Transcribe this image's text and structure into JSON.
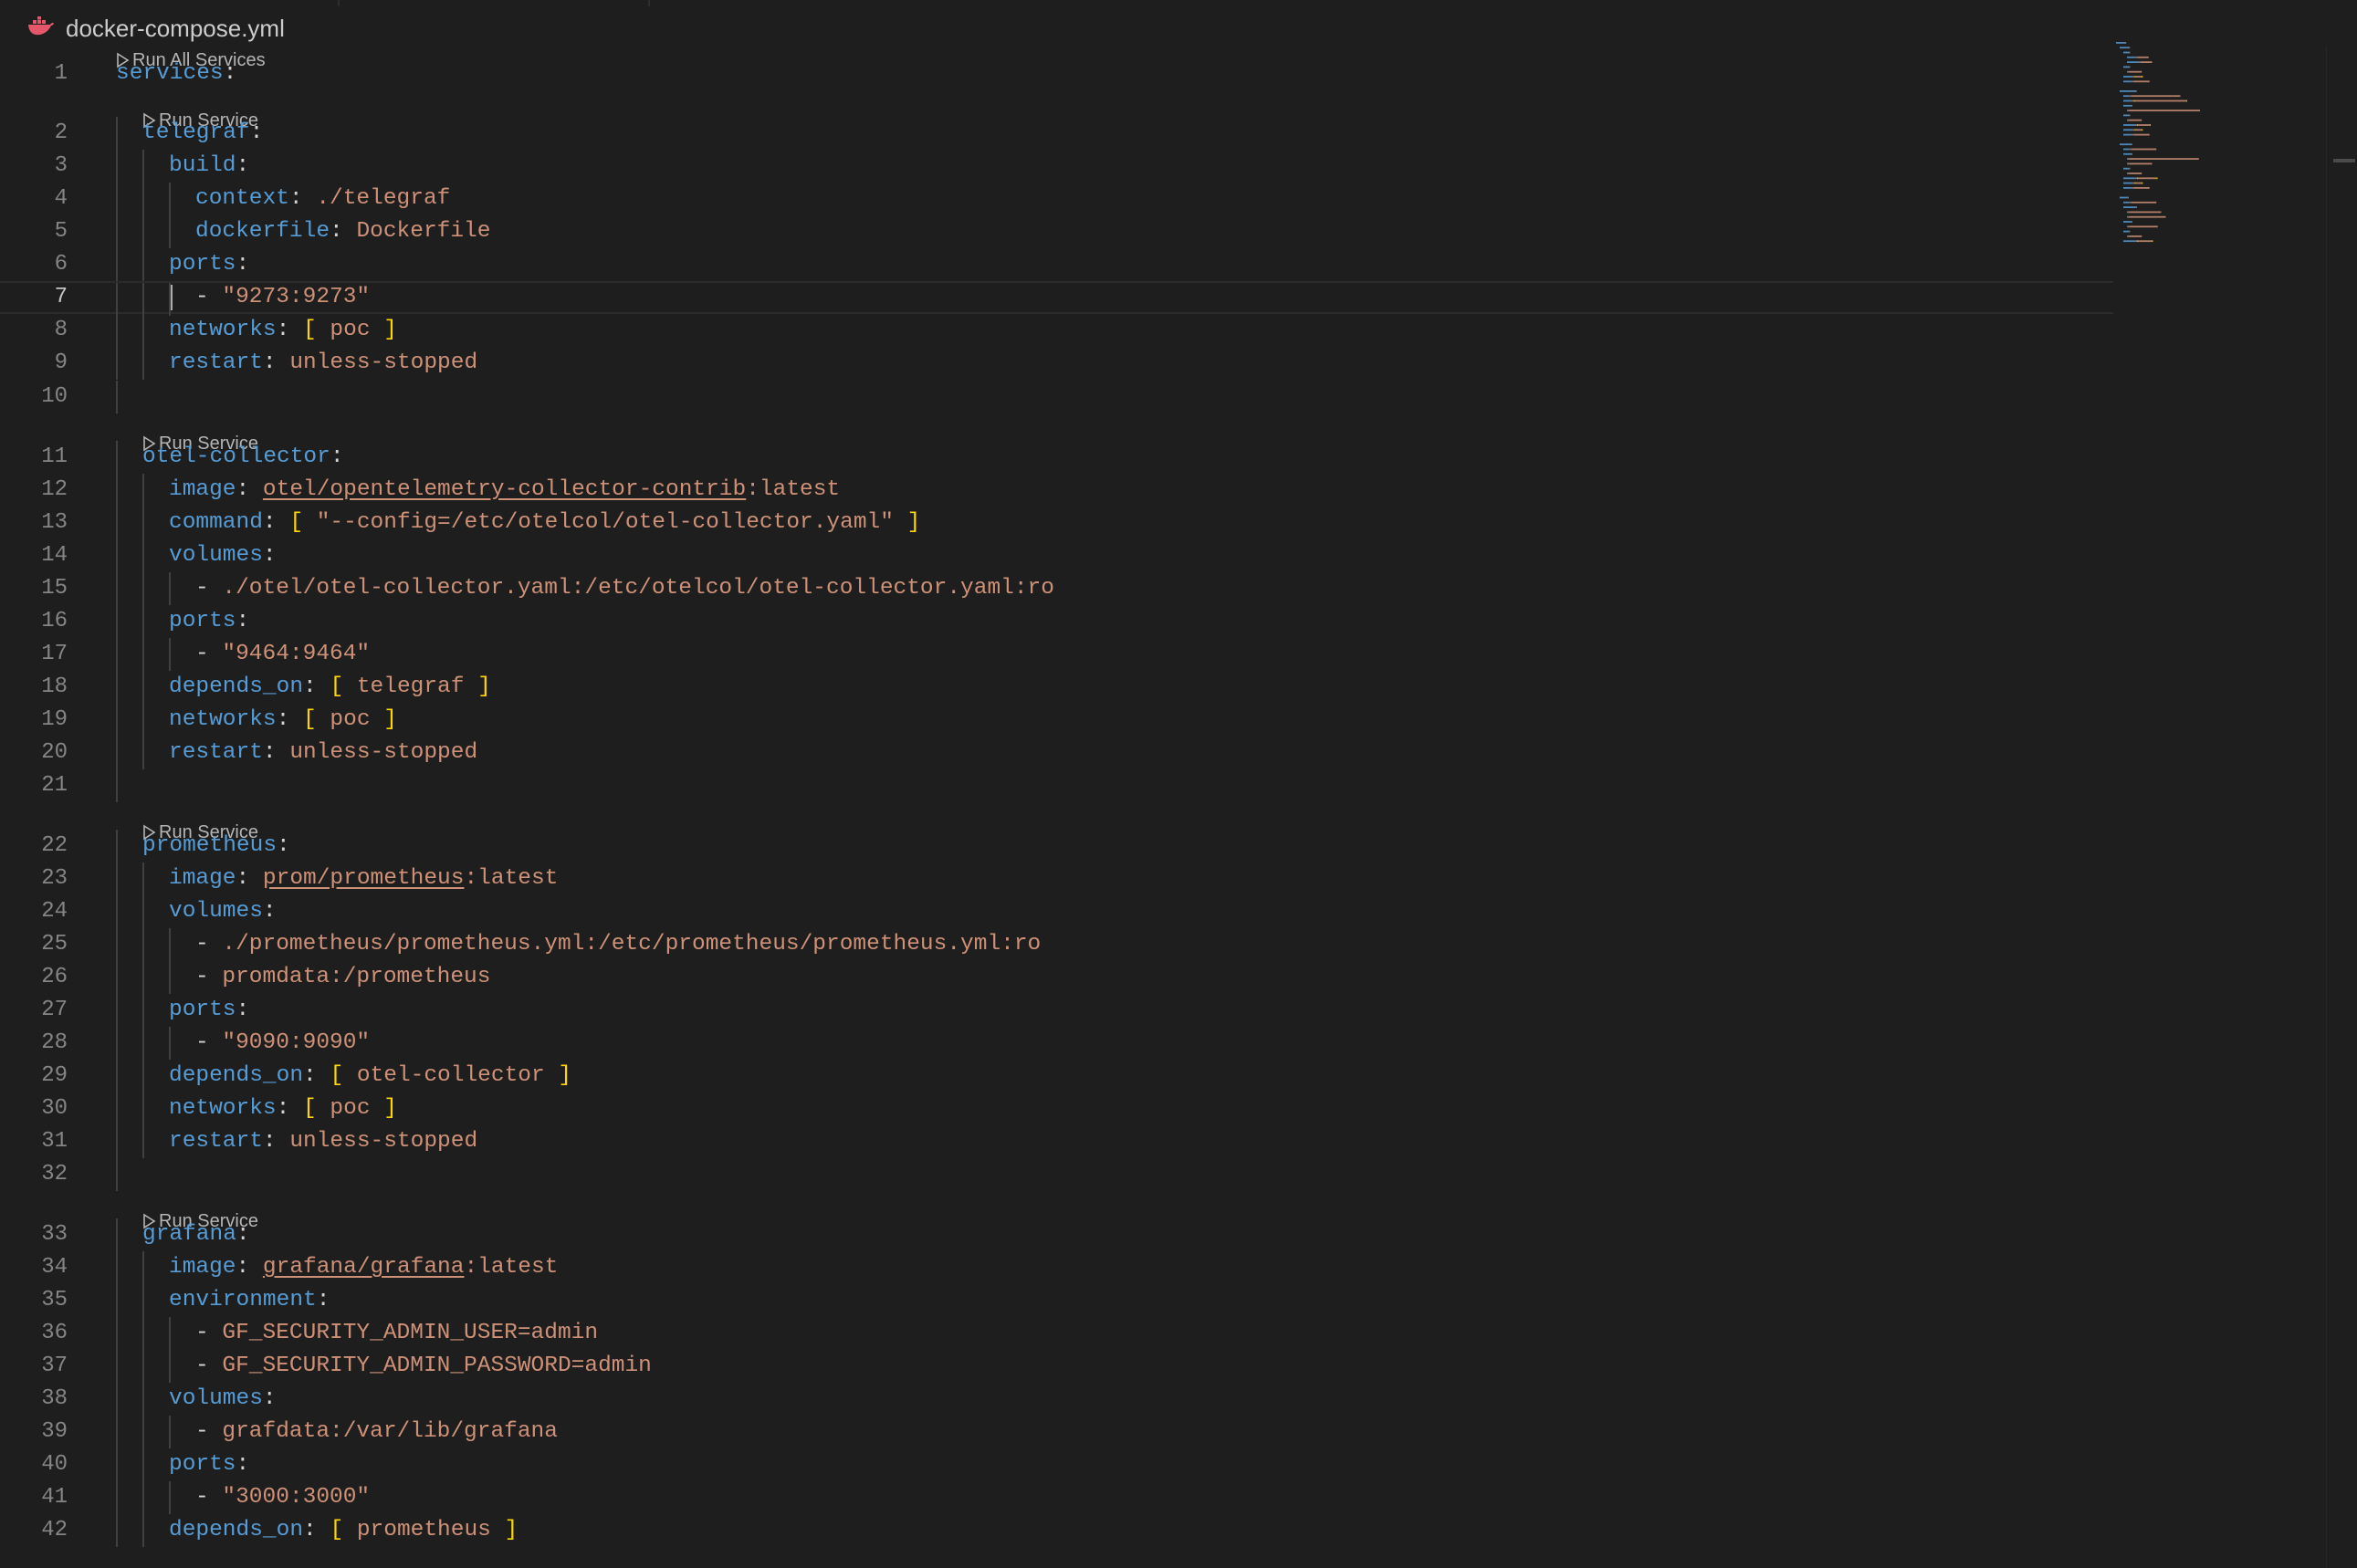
{
  "tab": {
    "title": "docker-compose.yml",
    "icon": "docker-whale-icon",
    "icon_color": "#e4576b"
  },
  "code_lens": {
    "run_all": "Run All Services",
    "run_service": "Run Service"
  },
  "active_line": 7,
  "lines": [
    {
      "n": "1",
      "seg": [
        {
          "t": "services",
          "c": "k"
        },
        {
          "t": ":",
          "c": "p"
        }
      ]
    },
    {
      "n": "2",
      "seg": [
        {
          "t": "telegraf",
          "c": "k"
        },
        {
          "t": ":",
          "c": "p"
        }
      ]
    },
    {
      "n": "3",
      "seg": [
        {
          "t": "build",
          "c": "k"
        },
        {
          "t": ":",
          "c": "p"
        }
      ]
    },
    {
      "n": "4",
      "seg": [
        {
          "t": "context",
          "c": "k"
        },
        {
          "t": ": ",
          "c": "p"
        },
        {
          "t": "./telegraf",
          "c": "v"
        }
      ]
    },
    {
      "n": "5",
      "seg": [
        {
          "t": "dockerfile",
          "c": "k"
        },
        {
          "t": ": ",
          "c": "p"
        },
        {
          "t": "Dockerfile",
          "c": "v"
        }
      ]
    },
    {
      "n": "6",
      "seg": [
        {
          "t": "ports",
          "c": "k"
        },
        {
          "t": ":",
          "c": "p"
        }
      ]
    },
    {
      "n": "7",
      "seg": [
        {
          "t": "- ",
          "c": "p"
        },
        {
          "t": "\"9273:9273\"",
          "c": "v"
        }
      ]
    },
    {
      "n": "8",
      "seg": [
        {
          "t": "networks",
          "c": "k"
        },
        {
          "t": ": ",
          "c": "p"
        },
        {
          "t": "[",
          "c": "b"
        },
        {
          "t": " poc ",
          "c": "v"
        },
        {
          "t": "]",
          "c": "b"
        }
      ]
    },
    {
      "n": "9",
      "seg": [
        {
          "t": "restart",
          "c": "k"
        },
        {
          "t": ": ",
          "c": "p"
        },
        {
          "t": "unless-stopped",
          "c": "v"
        }
      ]
    },
    {
      "n": "10",
      "seg": []
    },
    {
      "n": "11",
      "seg": [
        {
          "t": "otel-collector",
          "c": "k"
        },
        {
          "t": ":",
          "c": "p"
        }
      ]
    },
    {
      "n": "12",
      "seg": [
        {
          "t": "image",
          "c": "k"
        },
        {
          "t": ": ",
          "c": "p"
        },
        {
          "t": "otel/opentelemetry-collector-contrib",
          "c": "u"
        },
        {
          "t": ":latest",
          "c": "v"
        }
      ]
    },
    {
      "n": "13",
      "seg": [
        {
          "t": "command",
          "c": "k"
        },
        {
          "t": ": ",
          "c": "p"
        },
        {
          "t": "[",
          "c": "b"
        },
        {
          "t": " \"--config=/etc/otelcol/otel-collector.yaml\" ",
          "c": "v"
        },
        {
          "t": "]",
          "c": "b"
        }
      ]
    },
    {
      "n": "14",
      "seg": [
        {
          "t": "volumes",
          "c": "k"
        },
        {
          "t": ":",
          "c": "p"
        }
      ]
    },
    {
      "n": "15",
      "seg": [
        {
          "t": "- ",
          "c": "p"
        },
        {
          "t": "./otel/otel-collector.yaml:/etc/otelcol/otel-collector.yaml:ro",
          "c": "v"
        }
      ]
    },
    {
      "n": "16",
      "seg": [
        {
          "t": "ports",
          "c": "k"
        },
        {
          "t": ":",
          "c": "p"
        }
      ]
    },
    {
      "n": "17",
      "seg": [
        {
          "t": "- ",
          "c": "p"
        },
        {
          "t": "\"9464:9464\"",
          "c": "v"
        }
      ]
    },
    {
      "n": "18",
      "seg": [
        {
          "t": "depends_on",
          "c": "k"
        },
        {
          "t": ": ",
          "c": "p"
        },
        {
          "t": "[",
          "c": "b"
        },
        {
          "t": " telegraf ",
          "c": "v"
        },
        {
          "t": "]",
          "c": "b"
        }
      ]
    },
    {
      "n": "19",
      "seg": [
        {
          "t": "networks",
          "c": "k"
        },
        {
          "t": ": ",
          "c": "p"
        },
        {
          "t": "[",
          "c": "b"
        },
        {
          "t": " poc ",
          "c": "v"
        },
        {
          "t": "]",
          "c": "b"
        }
      ]
    },
    {
      "n": "20",
      "seg": [
        {
          "t": "restart",
          "c": "k"
        },
        {
          "t": ": ",
          "c": "p"
        },
        {
          "t": "unless-stopped",
          "c": "v"
        }
      ]
    },
    {
      "n": "21",
      "seg": []
    },
    {
      "n": "22",
      "seg": [
        {
          "t": "prometheus",
          "c": "k"
        },
        {
          "t": ":",
          "c": "p"
        }
      ]
    },
    {
      "n": "23",
      "seg": [
        {
          "t": "image",
          "c": "k"
        },
        {
          "t": ": ",
          "c": "p"
        },
        {
          "t": "prom/prometheus",
          "c": "u"
        },
        {
          "t": ":latest",
          "c": "v"
        }
      ]
    },
    {
      "n": "24",
      "seg": [
        {
          "t": "volumes",
          "c": "k"
        },
        {
          "t": ":",
          "c": "p"
        }
      ]
    },
    {
      "n": "25",
      "seg": [
        {
          "t": "- ",
          "c": "p"
        },
        {
          "t": "./prometheus/prometheus.yml:/etc/prometheus/prometheus.yml:ro",
          "c": "v"
        }
      ]
    },
    {
      "n": "26",
      "seg": [
        {
          "t": "- ",
          "c": "p"
        },
        {
          "t": "promdata:/prometheus",
          "c": "v"
        }
      ]
    },
    {
      "n": "27",
      "seg": [
        {
          "t": "ports",
          "c": "k"
        },
        {
          "t": ":",
          "c": "p"
        }
      ]
    },
    {
      "n": "28",
      "seg": [
        {
          "t": "- ",
          "c": "p"
        },
        {
          "t": "\"9090:9090\"",
          "c": "v"
        }
      ]
    },
    {
      "n": "29",
      "seg": [
        {
          "t": "depends_on",
          "c": "k"
        },
        {
          "t": ": ",
          "c": "p"
        },
        {
          "t": "[",
          "c": "b"
        },
        {
          "t": " otel-collector ",
          "c": "v"
        },
        {
          "t": "]",
          "c": "b"
        }
      ]
    },
    {
      "n": "30",
      "seg": [
        {
          "t": "networks",
          "c": "k"
        },
        {
          "t": ": ",
          "c": "p"
        },
        {
          "t": "[",
          "c": "b"
        },
        {
          "t": " poc ",
          "c": "v"
        },
        {
          "t": "]",
          "c": "b"
        }
      ]
    },
    {
      "n": "31",
      "seg": [
        {
          "t": "restart",
          "c": "k"
        },
        {
          "t": ": ",
          "c": "p"
        },
        {
          "t": "unless-stopped",
          "c": "v"
        }
      ]
    },
    {
      "n": "32",
      "seg": []
    },
    {
      "n": "33",
      "seg": [
        {
          "t": "grafana",
          "c": "k"
        },
        {
          "t": ":",
          "c": "p"
        }
      ]
    },
    {
      "n": "34",
      "seg": [
        {
          "t": "image",
          "c": "k"
        },
        {
          "t": ": ",
          "c": "p"
        },
        {
          "t": "grafana/grafana",
          "c": "u"
        },
        {
          "t": ":latest",
          "c": "v"
        }
      ]
    },
    {
      "n": "35",
      "seg": [
        {
          "t": "environment",
          "c": "k"
        },
        {
          "t": ":",
          "c": "p"
        }
      ]
    },
    {
      "n": "36",
      "seg": [
        {
          "t": "- ",
          "c": "p"
        },
        {
          "t": "GF_SECURITY_ADMIN_USER=admin",
          "c": "v"
        }
      ]
    },
    {
      "n": "37",
      "seg": [
        {
          "t": "- ",
          "c": "p"
        },
        {
          "t": "GF_SECURITY_ADMIN_PASSWORD=admin",
          "c": "v"
        }
      ]
    },
    {
      "n": "38",
      "seg": [
        {
          "t": "volumes",
          "c": "k"
        },
        {
          "t": ":",
          "c": "p"
        }
      ]
    },
    {
      "n": "39",
      "seg": [
        {
          "t": "- ",
          "c": "p"
        },
        {
          "t": "grafdata:/var/lib/grafana",
          "c": "v"
        }
      ]
    },
    {
      "n": "40",
      "seg": [
        {
          "t": "ports",
          "c": "k"
        },
        {
          "t": ":",
          "c": "p"
        }
      ]
    },
    {
      "n": "41",
      "seg": [
        {
          "t": "- ",
          "c": "p"
        },
        {
          "t": "\"3000:3000\"",
          "c": "v"
        }
      ]
    },
    {
      "n": "42",
      "seg": [
        {
          "t": "depends_on",
          "c": "k"
        },
        {
          "t": ": ",
          "c": "p"
        },
        {
          "t": "[",
          "c": "b"
        },
        {
          "t": " prometheus ",
          "c": "v"
        },
        {
          "t": "]",
          "c": "b"
        }
      ]
    }
  ]
}
